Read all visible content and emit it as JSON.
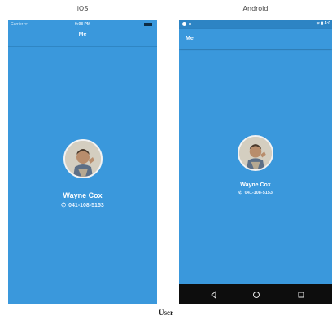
{
  "platforms": {
    "ios": "iOS",
    "android": "Android"
  },
  "ios": {
    "carrier": "Carrier ᯤ",
    "time": "9:08 PM",
    "title": "Me"
  },
  "android": {
    "status_right": "ᯤ ▮ 4:0",
    "title": "Me"
  },
  "user": {
    "name": "Wayne Cox",
    "phone": "041-108-5153"
  },
  "caption": "User",
  "icons": [
    "phone-icon",
    "back-icon",
    "home-icon",
    "recent-apps-icon",
    "wifi-icon",
    "battery-icon"
  ],
  "colors": {
    "accent": "#3a98dc",
    "status_dark": "#2d84c4",
    "nav_bar": "#0d0d0d"
  }
}
